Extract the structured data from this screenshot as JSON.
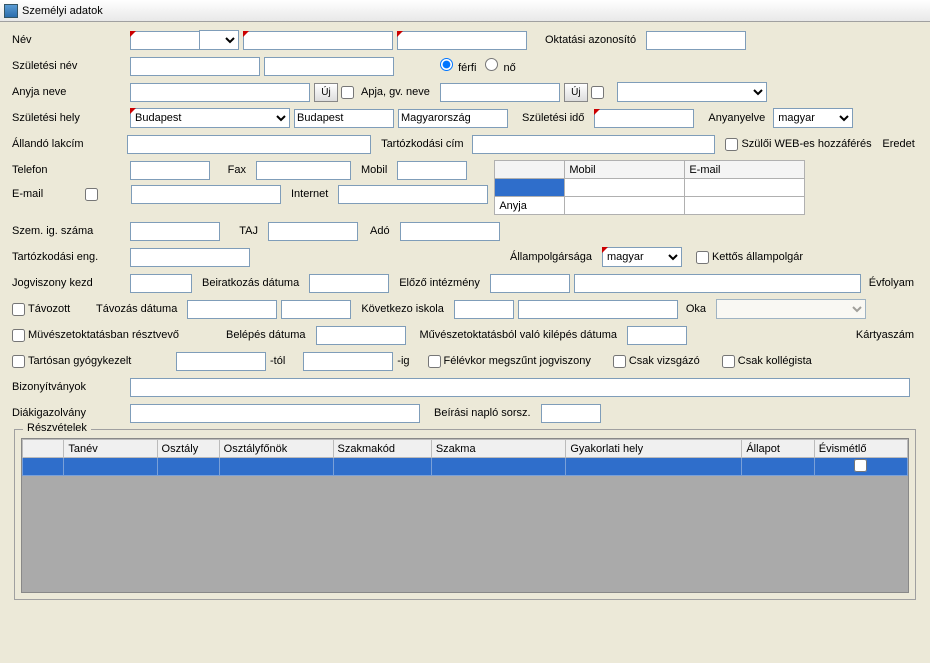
{
  "window": {
    "title": "Személyi adatok"
  },
  "labels": {
    "nev": "Név",
    "oktatasi_azon": "Oktatási azonosító",
    "szuletesi_nev": "Születési név",
    "ferfi": "férfi",
    "no": "nő",
    "anyja_neve": "Anyja neve",
    "uj": "Új",
    "apja_gv": "Apja, gv. neve",
    "szuletesi_hely": "Születési hely",
    "szuletesi_ido": "Születési idő",
    "anyanyelve": "Anyanyelve",
    "allando_lakcim": "Állandó lakcím",
    "tart_cim": "Tartózkodási cím",
    "szuloi_web": "Szülői WEB-es hozzáférés",
    "eredet": "Eredet",
    "telefon": "Telefon",
    "fax": "Fax",
    "mobil": "Mobil",
    "email": "E-mail",
    "internet": "Internet",
    "anyja": "Anyja",
    "szemig": "Szem. ig. száma",
    "taj": "TAJ",
    "ado": "Adó",
    "tartozkodasi_eng": "Tartózkodási eng.",
    "allampolg": "Állampolgársága",
    "kettos": "Kettős állampolgár",
    "jogviszony_kezd": "Jogviszony kezd",
    "beiratkozas": "Beiratkozás dátuma",
    "elozo_intezmeny": "Előző intézmény",
    "evfolyam": "Évfolyam",
    "tavozott": "Távozott",
    "tavozas_datuma": "Távozás dátuma",
    "kovetkezo_iskola": "Következo iskola",
    "oka": "Oka",
    "muveszet_reszt": "Müvészetoktatásban résztvevő",
    "belepes": "Belépés dátuma",
    "muveszet_kilepes": "Művészetoktatásból való kilépés dátuma",
    "kartyaszam": "Kártyaszám",
    "tartosan_gyogy": "Tartósan gyógykezelt",
    "tol": "-tól",
    "ig": "-ig",
    "felevkor": "Félévkor megszűnt jogviszony",
    "csak_vizsgazo": "Csak vizsgázó",
    "csak_kollegista": "Csak kollégista",
    "bizonyitvanyok": "Bizonyítványok",
    "diakigazolvany": "Diákigazolvány",
    "beirasi_naplo": "Beírási napló sorsz.",
    "reszvetelek": "Részvételek"
  },
  "values": {
    "szulhely_varos": "Budapest",
    "szulhely_varos2": "Budapest",
    "szulhely_orszag": "Magyarország",
    "anyanyelv": "magyar",
    "allampolg": "magyar"
  },
  "contact_grid": {
    "headers": [
      "",
      "Mobil",
      "E-mail"
    ],
    "rows": [
      [
        "",
        "",
        ""
      ],
      [
        "Anyja",
        "",
        ""
      ]
    ]
  },
  "reszvetelek_headers": [
    "",
    "Tanév",
    "Osztály",
    "Osztályfőnök",
    "Szakmakód",
    "Szakma",
    "Gyakorlati hely",
    "Állapot",
    "Évismétlő"
  ]
}
